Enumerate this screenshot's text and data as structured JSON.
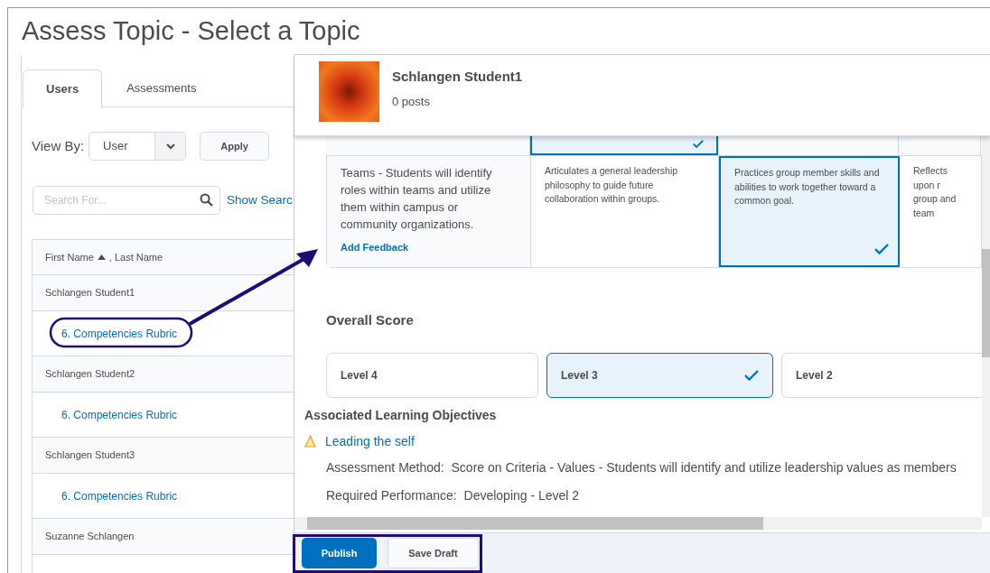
{
  "page_title": "Assess Topic - Select a Topic",
  "tabs": [
    {
      "label": "Users",
      "selected": true
    },
    {
      "label": "Assessments",
      "selected": false
    }
  ],
  "view_by": {
    "label": "View By:",
    "value": "User",
    "button": "Apply"
  },
  "search": {
    "placeholder": "Search For...",
    "link": "Show Searc"
  },
  "table": {
    "header_first": "First Name",
    "header_rest": ", Last Name",
    "rows": [
      {
        "name": "Schlangen Student1",
        "link": "6. Competencies Rubric",
        "circled": true
      },
      {
        "name": "Schlangen Student2",
        "link": "6. Competencies Rubric",
        "circled": false
      },
      {
        "name": "Schlangen Student3",
        "link": "6. Competencies Rubric",
        "circled": false
      },
      {
        "name": "Suzanne Schlangen",
        "circled": false
      }
    ]
  },
  "dialog": {
    "student": "Schlangen Student1",
    "posts": "0 posts",
    "rubric": {
      "top_cells": [
        {
          "selected": false
        },
        {
          "selected": true
        },
        {
          "selected": false
        },
        {
          "selected": false
        }
      ],
      "criterion": "Teams - Students will identify roles within teams and utilize them within campus or community organizations.",
      "feedback_link": "Add Feedback",
      "levels": [
        {
          "text": "Articulates a general leadership philosophy to guide future collaboration within groups.",
          "selected": false
        },
        {
          "text": "Practices group member skills and abilities to work together toward a common goal.",
          "selected": true
        },
        {
          "text": "Reflects upon r\ngroup and team",
          "selected": false
        }
      ]
    },
    "overall": {
      "title": "Overall Score",
      "levels": [
        {
          "label": "Level 4",
          "selected": false
        },
        {
          "label": "Level 3",
          "selected": true
        },
        {
          "label": "Level 2",
          "selected": false
        }
      ]
    },
    "objectives": {
      "title": "Associated Learning Objectives",
      "link": "Leading the self",
      "method_label": "Assessment Method:",
      "method": "Score on Criteria - Values - Students will identify and utilize leadership values as members",
      "performance_label": "Required Performance:",
      "performance": "Developing - Level 2"
    },
    "buttons": [
      {
        "label": "Publish",
        "kind": "primary"
      },
      {
        "label": "Save Draft",
        "kind": "secondary"
      }
    ],
    "buttons_boxed": true
  }
}
